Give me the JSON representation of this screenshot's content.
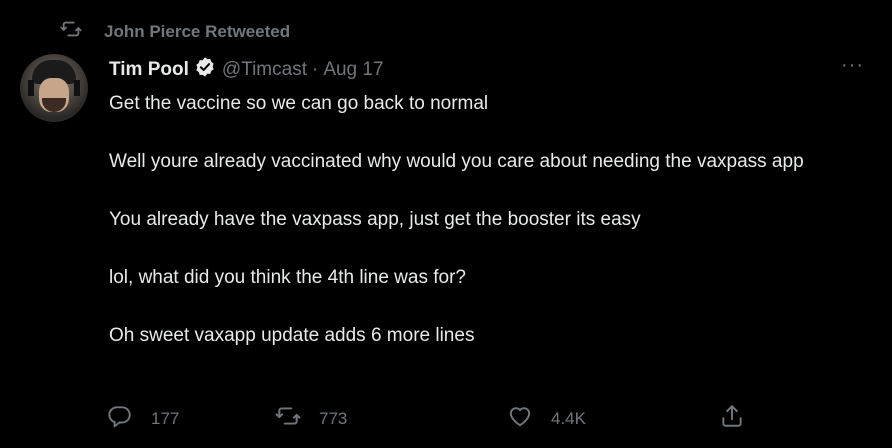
{
  "retweet_context": {
    "icon": "retweet-icon",
    "text": "John Pierce Retweeted"
  },
  "tweet": {
    "author_name": "Tim Pool",
    "verified": true,
    "handle": "@Timcast",
    "separator": "·",
    "date": "Aug 17",
    "more_label": "···",
    "lines": [
      "Get the vaccine so we can go back to normal",
      "Well youre already vaccinated why would you care about needing the vaxpass app",
      "You already have the vaxpass app, just get the booster its easy",
      "lol, what did you think the 4th line was for?",
      "Oh sweet vaxapp update adds 6 more lines"
    ]
  },
  "actions": {
    "reply_count": "177",
    "retweet_count": "773",
    "like_count": "4.4K"
  },
  "colors": {
    "background": "#000000",
    "text": "#e7e9ea",
    "secondary": "#71767b",
    "verified": "#1d9bf0"
  }
}
